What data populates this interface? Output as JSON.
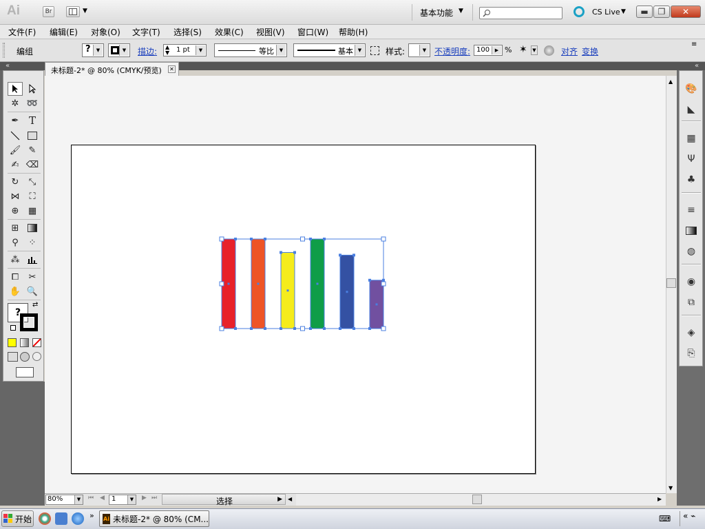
{
  "app": {
    "logo": "Ai",
    "bridge_label": "Br",
    "workspace": "基本功能",
    "cs_live": "CS Live",
    "search_placeholder": ""
  },
  "menu": [
    "文件(F)",
    "编辑(E)",
    "对象(O)",
    "文字(T)",
    "选择(S)",
    "效果(C)",
    "视图(V)",
    "窗口(W)",
    "帮助(H)"
  ],
  "control_bar": {
    "selection_type": "编组",
    "fill_label": "?",
    "stroke_link": "描边:",
    "stroke_weight": "1 pt",
    "profile_label": "等比",
    "brush_label": "基本",
    "style_label": "样式:",
    "opacity_link": "不透明度:",
    "opacity_value": "100",
    "opacity_unit": "%",
    "align_link": "对齐",
    "transform_link": "变换"
  },
  "document": {
    "tab_title": "未标题-2* @ 80% (CMYK/预览)",
    "tab_close": "✕"
  },
  "artwork": {
    "bars": [
      {
        "color": "#e8212a",
        "height_fraction": 1.0
      },
      {
        "color": "#ee5426",
        "height_fraction": 1.0
      },
      {
        "color": "#f5ec1c",
        "height_fraction": 0.85
      },
      {
        "color": "#0f9d48",
        "height_fraction": 1.0
      },
      {
        "color": "#3451a3",
        "height_fraction": 0.82
      },
      {
        "color": "#7150a0",
        "height_fraction": 0.54
      }
    ],
    "selection_color": "#4a7fe0"
  },
  "status_bar": {
    "zoom": "80%",
    "artboard_number": "1",
    "status_text": "选择"
  },
  "toolbox": {
    "fill_stroke_label": "?"
  },
  "taskbar": {
    "start_label": "开始",
    "task_item": "未标题-2* @ 80% (CM..."
  }
}
